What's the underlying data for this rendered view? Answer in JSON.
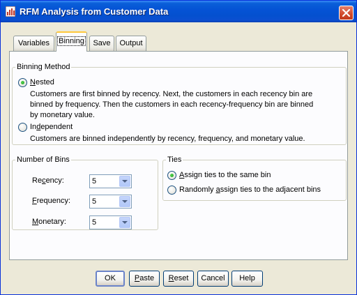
{
  "window": {
    "title": "RFM Analysis from Customer Data"
  },
  "tabs": [
    {
      "label": "Variables",
      "active": false
    },
    {
      "label": "Binning",
      "active": true
    },
    {
      "label": "Save",
      "active": false
    },
    {
      "label": "Output",
      "active": false
    }
  ],
  "binning_method": {
    "legend": "Binning Method",
    "nested": {
      "label_prefix": "",
      "label_underline": "N",
      "label_rest": "ested",
      "checked": true,
      "description_lines": [
        "Customers are first binned by recency. Next, the customers in each recency bin are",
        "binned by frequency. Then the customers in each recency-frequency bin are binned",
        "by monetary value."
      ]
    },
    "independent": {
      "label_prefix": "In",
      "label_underline": "d",
      "label_rest": "ependent",
      "checked": false,
      "description_lines": [
        "Customers are binned independently by recency, frequency, and monetary value."
      ]
    }
  },
  "number_of_bins": {
    "legend": "Number of Bins",
    "recency": {
      "prefix": "Re",
      "underline": "c",
      "rest": "ency:",
      "value": "5"
    },
    "frequency": {
      "prefix": "",
      "underline": "F",
      "rest": "requency:",
      "value": "5"
    },
    "monetary": {
      "prefix": "",
      "underline": "M",
      "rest": "onetary:",
      "value": "5"
    }
  },
  "ties": {
    "legend": "Ties",
    "same_bin": {
      "prefix": "",
      "underline": "A",
      "rest": "ssign ties to the same bin",
      "checked": true
    },
    "adjacent": {
      "prefix": "Randomly ",
      "underline": "a",
      "rest": "ssign ties to the adjacent bins",
      "checked": false
    }
  },
  "buttons": {
    "ok": {
      "prefix": "",
      "underline": "",
      "rest": "OK"
    },
    "paste": {
      "prefix": "",
      "underline": "P",
      "rest": "aste"
    },
    "reset": {
      "prefix": "",
      "underline": "R",
      "rest": "eset"
    },
    "cancel": {
      "prefix": "",
      "underline": "",
      "rest": "Cancel"
    },
    "help": {
      "prefix": "",
      "underline": "",
      "rest": "Help"
    }
  },
  "colors": {
    "titlebar": "#0553d5",
    "dialog_bg": "#ece9d8",
    "panel_bg": "#fcfcfe",
    "close_button": "#d04a2d",
    "active_tab_highlight": "#ffc83c"
  },
  "icons": {
    "app": "spss-chart-icon",
    "close": "close-icon",
    "dropdown": "chevron-down-icon"
  }
}
